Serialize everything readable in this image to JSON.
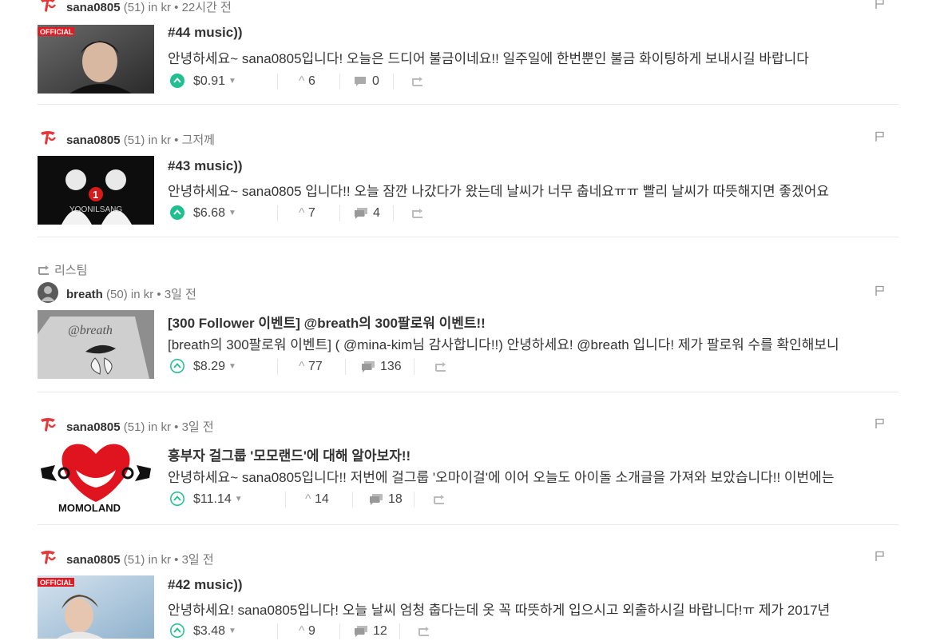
{
  "posts": [
    {
      "author": "sana0805",
      "rep": "(51)",
      "category": "kr",
      "time": "22시간 전",
      "thumb_badge": "OFFICIAL",
      "title": "#44 music))",
      "body": "안녕하세요~ sana0805입니다! 오늘은 드디어 불금이네요!! 일주일에 한번뿐인 불금 화이팅하게 보내시길 바랍니다",
      "payout": "$0.91",
      "votes": "6",
      "comments": "0"
    },
    {
      "author": "sana0805",
      "rep": "(51)",
      "category": "kr",
      "time": "그저께",
      "thumb_text": "YOONILSANG",
      "title": "#43 music))",
      "body": "안녕하세요~ sana0805 입니다!! 오늘 잠깐 나갔다가 왔는데 날씨가 너무 춥네요ㅠㅠ 빨리 날씨가 따뜻해지면 좋겠어요",
      "payout": "$6.68",
      "votes": "7",
      "comments": "4"
    },
    {
      "resteem_label": "리스팀",
      "author": "breath",
      "rep": "(50)",
      "category": "kr",
      "time": "3일 전",
      "thumb_text": "@breath",
      "title": "[300 Follower 이벤트] @breath의 300팔로워 이벤트!!",
      "body": "[breath의 300팔로워 이벤트] ( @mina-kim님 감사합니다!!) 안녕하세요! @breath 입니다! 제가 팔로워 수를 확인해보니",
      "payout": "$8.29",
      "votes": "77",
      "comments": "136"
    },
    {
      "author": "sana0805",
      "rep": "(51)",
      "category": "kr",
      "time": "3일 전",
      "thumb_text": "MOMOLAND",
      "title": "흥부자 걸그룹 '모모랜드'에 대해 알아보자!!",
      "body": "안녕하세요~ sana0805입니다!! 저번에 걸그룹 '오마이걸'에 이어 오늘도 아이돌 소개글을 가져와 보았습니다!! 이번에는",
      "payout": "$11.14",
      "votes": "14",
      "comments": "18"
    },
    {
      "author": "sana0805",
      "rep": "(51)",
      "category": "kr",
      "time": "3일 전",
      "thumb_badge": "OFFICIAL",
      "title": "#42 music))",
      "body": "안녕하세요! sana0805입니다! 오늘 날씨 엄청 춥다는데 옷 꼭 따뜻하게 입으시고 외출하시길 바랍니다!ㅠ 제가 2017년",
      "payout": "$3.48",
      "votes": "9",
      "comments": "12"
    }
  ],
  "labels": {
    "in": "in",
    "dot": "•"
  },
  "colors": {
    "accent": "#1fbf8f",
    "text": "#333333",
    "muted": "#777777",
    "twice_red": "#e23a3a"
  }
}
